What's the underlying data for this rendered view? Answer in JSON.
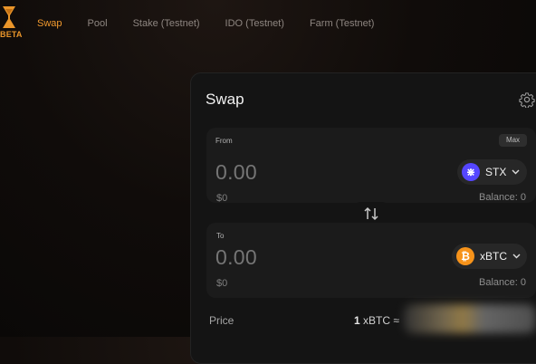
{
  "header": {
    "logo_badge": "BETA",
    "nav": [
      {
        "label": "Swap",
        "active": true
      },
      {
        "label": "Pool",
        "active": false
      },
      {
        "label": "Stake (Testnet)",
        "active": false
      },
      {
        "label": "IDO (Testnet)",
        "active": false
      },
      {
        "label": "Farm (Testnet)",
        "active": false
      }
    ]
  },
  "swap": {
    "title": "Swap",
    "settings_icon": "gear-icon",
    "from": {
      "label": "From",
      "max_label": "Max",
      "amount": "0.00",
      "usd": "$0",
      "token": "STX",
      "token_icon": "stx-icon",
      "balance": "Balance: 0"
    },
    "switch_icon": "swap-arrows-icon",
    "to": {
      "label": "To",
      "amount": "0.00",
      "usd": "$0",
      "token": "xBTC",
      "token_icon": "xbtc-icon",
      "balance": "Balance: 0"
    },
    "price": {
      "label": "Price",
      "base_amount": "1",
      "base_token": "xBTC",
      "approx": "≈"
    }
  },
  "colors": {
    "accent": "#f29a2e",
    "stx": "#5546ff",
    "btc": "#f7931a"
  }
}
